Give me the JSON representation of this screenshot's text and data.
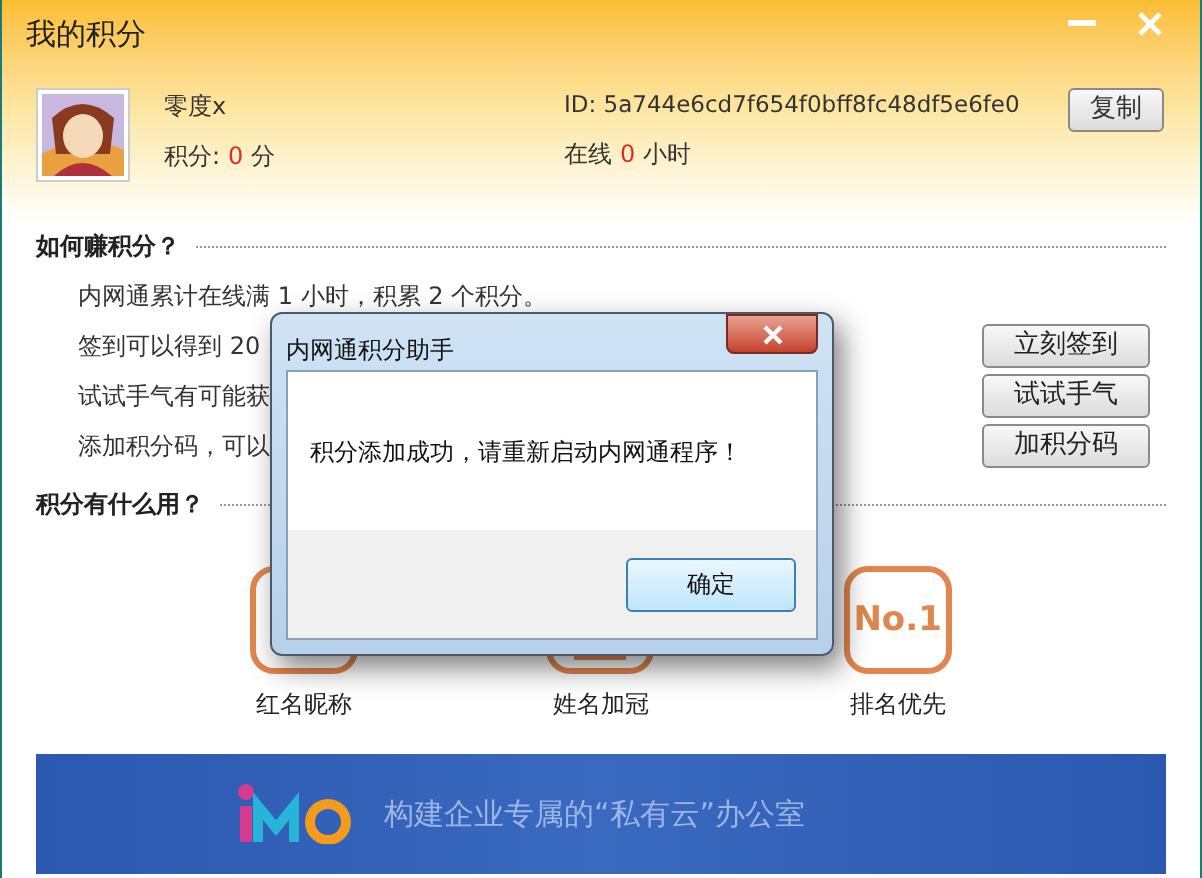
{
  "window": {
    "title": "我的积分"
  },
  "profile": {
    "name": "零度x",
    "points_label": "积分:",
    "points": "0",
    "points_unit": "分",
    "id": "ID: 5a744e6cd7f654f0bff8fc48df5e6fe0",
    "online_label": "在线",
    "online": "0",
    "online_unit": "小时",
    "copy_button": "复制"
  },
  "earn": {
    "heading": "如何赚积分？",
    "rows": [
      {
        "text": "内网通累计在线满 1 小时，积累 2 个积分。"
      },
      {
        "text": "签到可以得到 20",
        "button": "立刻签到"
      },
      {
        "text": "试试手气有可能获",
        "button": "试试手气"
      },
      {
        "text": "添加积分码，可以",
        "button": "加积分码"
      }
    ]
  },
  "use": {
    "heading": "积分有什么用？",
    "items": [
      {
        "kind": "nickname",
        "label": "红名昵称"
      },
      {
        "kind": "crown",
        "label": "姓名加冠"
      },
      {
        "kind": "rank",
        "glyph": "No.1",
        "label": "排名优先"
      }
    ]
  },
  "banner": {
    "slogan": "构建企业专属的“私有云”办公室"
  },
  "dialog": {
    "title": "内网通积分助手",
    "message": "积分添加成功，请重新启动内网通程序！",
    "ok": "确定"
  }
}
